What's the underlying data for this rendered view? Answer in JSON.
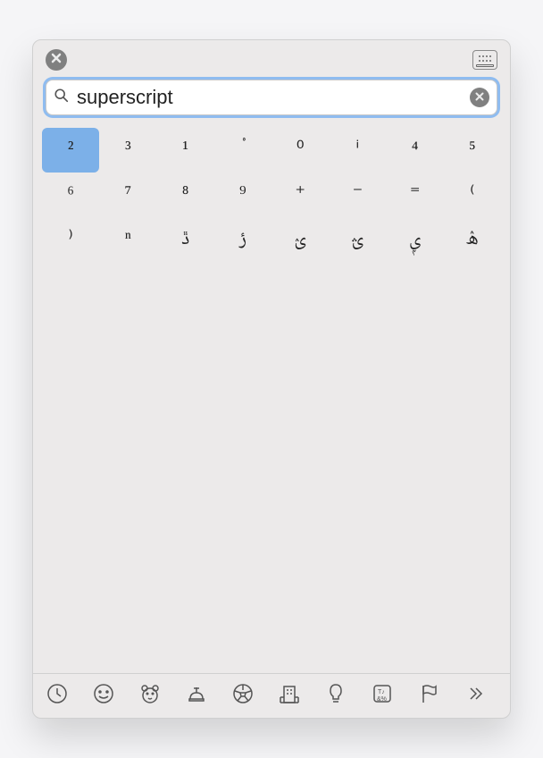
{
  "search": {
    "value": "superscript",
    "placeholder": "Search"
  },
  "results": [
    {
      "char": "²",
      "name": "superscript-two",
      "selected": true
    },
    {
      "char": "³",
      "name": "superscript-three"
    },
    {
      "char": "¹",
      "name": "superscript-one"
    },
    {
      "char": "ْ",
      "name": "arabic-sukun"
    },
    {
      "char": "⁰",
      "name": "superscript-zero"
    },
    {
      "char": "ⁱ",
      "name": "superscript-i"
    },
    {
      "char": "⁴",
      "name": "superscript-four"
    },
    {
      "char": "⁵",
      "name": "superscript-five"
    },
    {
      "char": "⁶",
      "name": "superscript-six"
    },
    {
      "char": "⁷",
      "name": "superscript-seven"
    },
    {
      "char": "⁸",
      "name": "superscript-eight"
    },
    {
      "char": "⁹",
      "name": "superscript-nine"
    },
    {
      "char": "⁺",
      "name": "superscript-plus"
    },
    {
      "char": "⁻",
      "name": "superscript-minus"
    },
    {
      "char": "⁼",
      "name": "superscript-equals"
    },
    {
      "char": "⁽",
      "name": "superscript-left-paren"
    },
    {
      "char": "⁾",
      "name": "superscript-right-paren"
    },
    {
      "char": "ⁿ",
      "name": "superscript-n"
    },
    {
      "char": "ڐ",
      "name": "arabic-dal-superscript"
    },
    {
      "char": "ݬ",
      "name": "arabic-reh-superscript"
    },
    {
      "char": "ؽ",
      "name": "arabic-yeh-superscript-1"
    },
    {
      "char": "ؿ",
      "name": "arabic-yeh-superscript-2"
    },
    {
      "char": "ݷ",
      "name": "arabic-yeh-superscript-3"
    },
    {
      "char": "ۿ",
      "name": "arabic-heh-superscript"
    }
  ],
  "categories": [
    {
      "name": "frequently-used",
      "icon": "clock"
    },
    {
      "name": "smileys-people",
      "icon": "smiley"
    },
    {
      "name": "animals-nature",
      "icon": "bear"
    },
    {
      "name": "food-drink",
      "icon": "food"
    },
    {
      "name": "activity",
      "icon": "soccer"
    },
    {
      "name": "travel-places",
      "icon": "building"
    },
    {
      "name": "objects",
      "icon": "bulb"
    },
    {
      "name": "symbols",
      "icon": "symbols"
    },
    {
      "name": "flags",
      "icon": "flag"
    },
    {
      "name": "more",
      "icon": "chevrons"
    }
  ]
}
